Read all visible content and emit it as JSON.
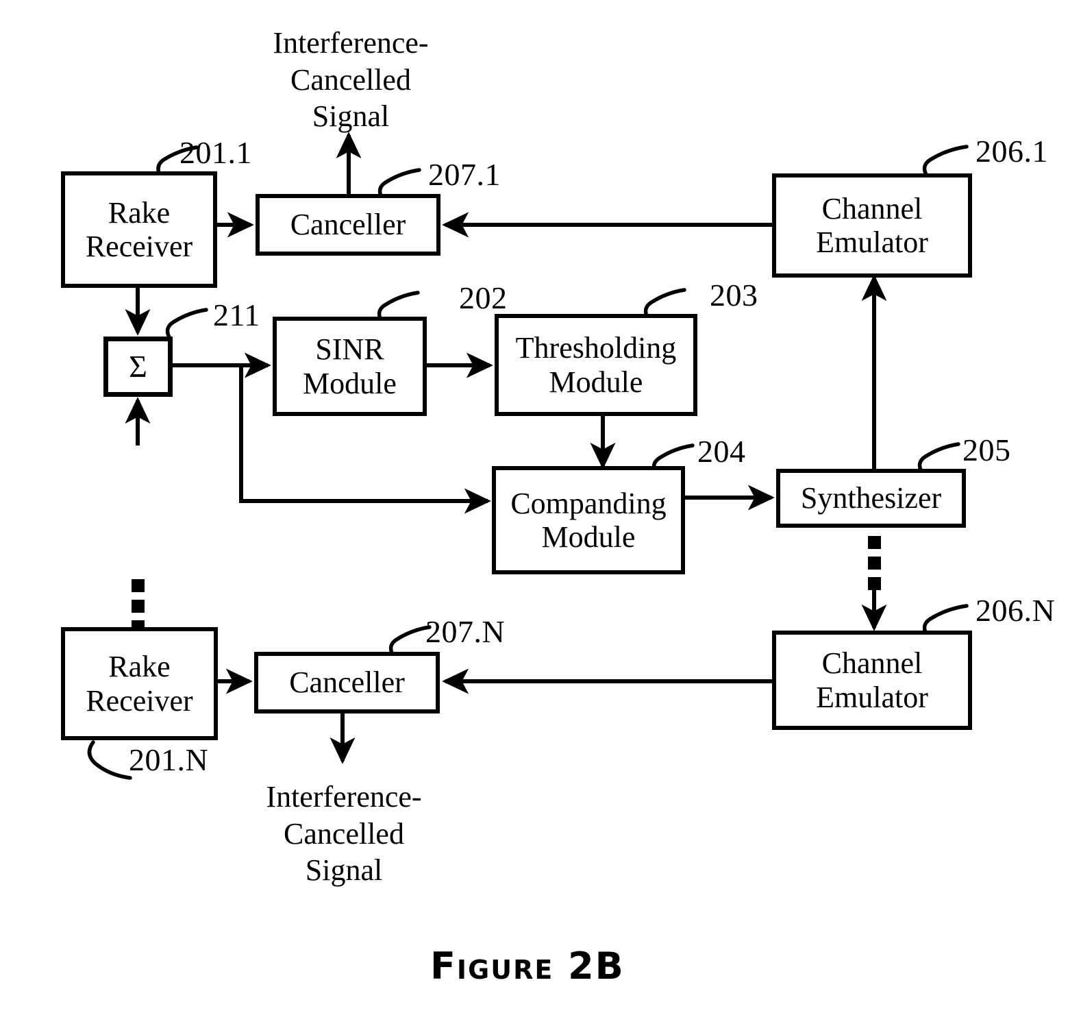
{
  "figure": {
    "caption": "Figure 2B",
    "type": "block-diagram"
  },
  "blocks": [
    {
      "id": "rake1",
      "label": "Rake\nReceiver",
      "ref": "201.1"
    },
    {
      "id": "canceller1",
      "label": "Canceller",
      "ref": "207.1"
    },
    {
      "id": "chan_emu1",
      "label": "Channel\nEmulator",
      "ref": "206.1"
    },
    {
      "id": "summer",
      "label": "Σ",
      "ref": "211"
    },
    {
      "id": "sinr",
      "label": "SINR\nModule",
      "ref": "202"
    },
    {
      "id": "thresholding",
      "label": "Thresholding\nModule",
      "ref": "203"
    },
    {
      "id": "companding",
      "label": "Companding\nModule",
      "ref": "204"
    },
    {
      "id": "synthesizer",
      "label": "Synthesizer",
      "ref": "205"
    },
    {
      "id": "rakeN",
      "label": "Rake\nReceiver",
      "ref": "201.N"
    },
    {
      "id": "cancellerN",
      "label": "Canceller",
      "ref": "207.N"
    },
    {
      "id": "chan_emuN",
      "label": "Channel\nEmulator",
      "ref": "206.N"
    }
  ],
  "annotations": {
    "output_top": "Interference-\nCancelled\nSignal",
    "output_bottom": "Interference-\nCancelled\nSignal"
  },
  "colors": {
    "stroke": "#000000",
    "background": "#ffffff"
  }
}
